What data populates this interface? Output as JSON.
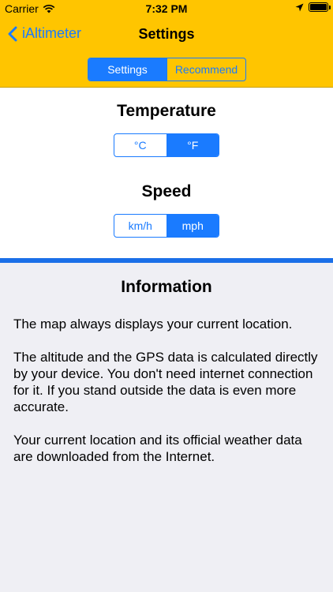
{
  "status_bar": {
    "carrier": "Carrier",
    "time": "7:32 PM",
    "wifi_icon": "wifi-icon",
    "location_icon": "location-arrow-icon",
    "battery_icon": "battery-icon"
  },
  "nav": {
    "back_label": "iAltimeter",
    "title": "Settings"
  },
  "top_tabs": {
    "items": [
      "Settings",
      "Recommend"
    ],
    "selected": "Settings"
  },
  "temperature": {
    "title": "Temperature",
    "options": [
      "°C",
      "°F"
    ],
    "selected": "°F"
  },
  "speed": {
    "title": "Speed",
    "options": [
      "km/h",
      "mph"
    ],
    "selected": "mph"
  },
  "information": {
    "title": "Information",
    "paragraphs": [
      "The map always displays your current location.",
      "The altitude and the GPS data is calculated directly by your device. You don't need internet connection for it. If you stand outside the data is even more accurate.",
      "Your current location and its official weather data are downloaded from the Internet."
    ]
  },
  "colors": {
    "nav_background": "#ffc500",
    "accent": "#1a7bff",
    "divider": "#1a6fe8",
    "page_background": "#efeff4"
  }
}
